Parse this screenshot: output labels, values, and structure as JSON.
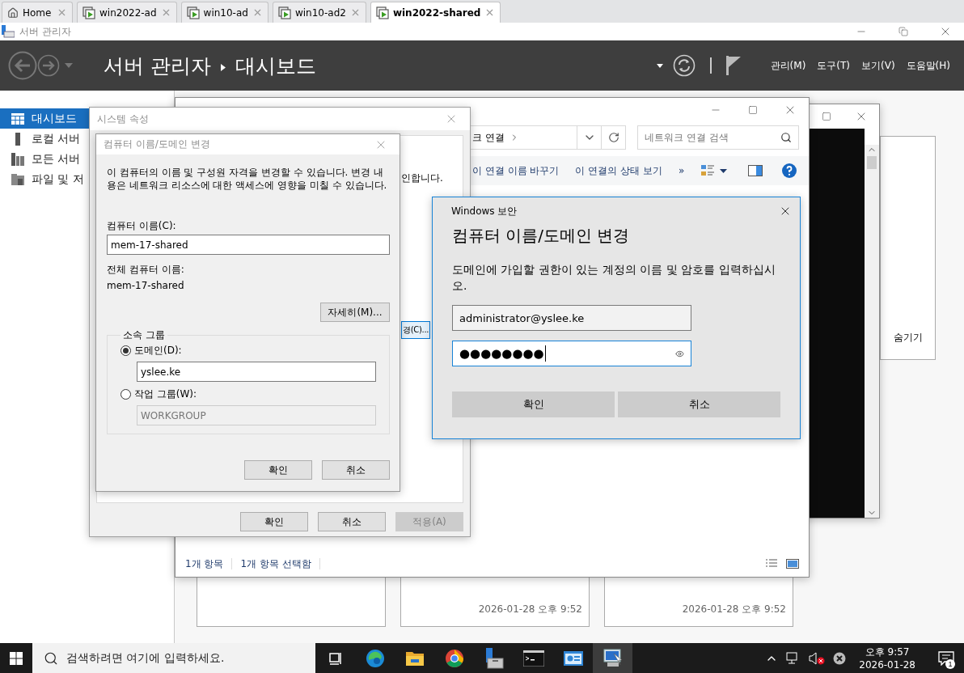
{
  "browser_tabs": [
    {
      "label": "Home",
      "kind": "home",
      "selected": false
    },
    {
      "label": "win2022-ad",
      "kind": "vm",
      "selected": false
    },
    {
      "label": "win10-ad",
      "kind": "vm",
      "selected": false
    },
    {
      "label": "win10-ad2",
      "kind": "vm",
      "selected": false
    },
    {
      "label": "win2022-shared",
      "kind": "vm",
      "selected": true
    }
  ],
  "server_manager": {
    "window_title": "서버 관리자",
    "breadcrumb": [
      "서버 관리자",
      "대시보드"
    ],
    "menu": [
      "관리(M)",
      "도구(T)",
      "보기(V)",
      "도움말(H)"
    ],
    "sidebar": [
      {
        "label": "대시보드",
        "kind": "dashboard",
        "selected": true
      },
      {
        "label": "로컬 서버",
        "kind": "server",
        "selected": false
      },
      {
        "label": "모든 서버",
        "kind": "servers",
        "selected": false
      },
      {
        "label": "파일 및 저",
        "kind": "files",
        "selected": false
      }
    ],
    "hide_label": "숨기기",
    "tiles": [
      {
        "kind": "blank"
      },
      {
        "kind": "dated",
        "timestamp": "2026-01-28 오후 9:52"
      },
      {
        "kind": "dated",
        "timestamp": "2026-01-28 오후 9:52"
      }
    ]
  },
  "network_window": {
    "address": "크 연결",
    "search_placeholder": "네트워크 연결 검색",
    "commands": [
      "이 연결 이름 바꾸기",
      "이 연결의 상태 보기"
    ],
    "more": "»",
    "status": [
      "1개 항목",
      "1개 항목 선택함"
    ]
  },
  "system_properties": {
    "title": "시스템 속성",
    "partial_text": "인합니다.",
    "change_button": "경(C)...",
    "buttons": [
      {
        "label": "확인",
        "disabled": false
      },
      {
        "label": "취소",
        "disabled": false
      },
      {
        "label": "적용(A)",
        "disabled": true
      }
    ]
  },
  "computer_name_dialog": {
    "title": "컴퓨터 이름/도메인 변경",
    "description": "이 컴퓨터의 이름 및 구성원 자격을 변경할 수 있습니다. 변경 내용은 네트워크 리소스에 대한 액세스에 영향을 미칠 수 있습니다.",
    "name_label": "컴퓨터 이름(C):",
    "name_value": "mem-17-shared",
    "full_name_label": "전체 컴퓨터 이름:",
    "full_name": "mem-17-shared",
    "more_button": "자세히(M)...",
    "group_label": "소속 그룹",
    "membership": [
      {
        "label": "도메인(D):",
        "selected": true,
        "value": "yslee.ke"
      },
      {
        "label": "작업 그룹(W):",
        "selected": false,
        "value": "WORKGROUP"
      }
    ],
    "buttons": [
      "확인",
      "취소"
    ]
  },
  "security_dialog": {
    "header": "Windows 보안",
    "title": "컴퓨터 이름/도메인 변경",
    "message": "도메인에 가입할 권한이 있는 계정의 이름 및 암호를 입력하십시오.",
    "username": "administrator@yslee.ke",
    "password": "●●●●●●●●",
    "buttons": [
      "확인",
      "취소"
    ]
  },
  "taskbar": {
    "search_placeholder": "검색하려면 여기에 입력하세요.",
    "apps": [
      {
        "kind": "task-view",
        "selected": false
      },
      {
        "kind": "edge",
        "selected": false
      },
      {
        "kind": "explorer",
        "selected": false
      },
      {
        "kind": "chrome",
        "selected": false
      },
      {
        "kind": "server-manager",
        "selected": false
      },
      {
        "kind": "terminal",
        "selected": false
      },
      {
        "kind": "control-panel",
        "selected": false
      },
      {
        "kind": "system",
        "selected": true
      }
    ],
    "time": "오후 9:57",
    "date": "2026-01-28",
    "notifications": "1"
  }
}
